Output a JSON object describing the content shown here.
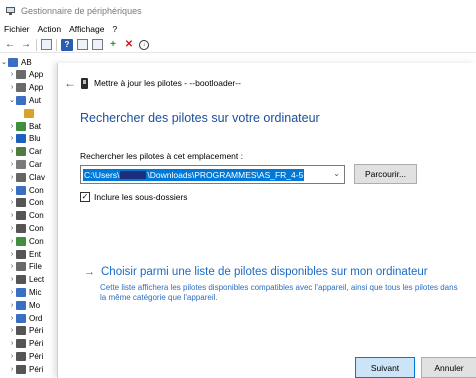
{
  "app": {
    "title": "Gestionnaire de périphériques"
  },
  "menu": [
    {
      "id": "fichier",
      "label": "Fichier"
    },
    {
      "id": "action",
      "label": "Action"
    },
    {
      "id": "affichage",
      "label": "Affichage"
    },
    {
      "id": "help",
      "label": "?"
    }
  ],
  "toolbar": [
    {
      "id": "back",
      "icon": "arrow-left-icon",
      "glyph": "←"
    },
    {
      "id": "forward",
      "icon": "arrow-right-icon",
      "glyph": "→"
    },
    {
      "id": "properties",
      "icon": "properties-icon",
      "glyph": ""
    },
    {
      "id": "help",
      "icon": "help-icon",
      "glyph": "?"
    },
    {
      "id": "update-driver",
      "icon": "update-driver-icon",
      "glyph": ""
    },
    {
      "id": "scan",
      "icon": "monitor-scan-icon",
      "glyph": ""
    },
    {
      "id": "add-legacy",
      "icon": "add-device-icon",
      "glyph": "+"
    },
    {
      "id": "uninstall",
      "icon": "uninstall-icon",
      "glyph": "✕"
    },
    {
      "id": "download",
      "icon": "download-icon",
      "glyph": "↓"
    }
  ],
  "tree": [
    {
      "label": "AB",
      "twisty": "⌄",
      "indent": 0,
      "color": "#3a6fc4"
    },
    {
      "label": "App",
      "twisty": "›",
      "indent": 1,
      "color": "#6a6a6a"
    },
    {
      "label": "App",
      "twisty": "›",
      "indent": 1,
      "color": "#6a6a6a"
    },
    {
      "label": "Aut",
      "twisty": "⌄",
      "indent": 1,
      "color": "#3a6fc4"
    },
    {
      "label": "",
      "twisty": "",
      "indent": 2,
      "color": "#d8a32a"
    },
    {
      "label": "Bat",
      "twisty": "›",
      "indent": 1,
      "color": "#3f8f3f"
    },
    {
      "label": "Blu",
      "twisty": "›",
      "indent": 1,
      "color": "#1e5fbf"
    },
    {
      "label": "Car",
      "twisty": "›",
      "indent": 1,
      "color": "#4f7d3f"
    },
    {
      "label": "Car",
      "twisty": "›",
      "indent": 1,
      "color": "#7a7a7a"
    },
    {
      "label": "Clav",
      "twisty": "›",
      "indent": 1,
      "color": "#666"
    },
    {
      "label": "Con",
      "twisty": "›",
      "indent": 1,
      "color": "#3a6fc4"
    },
    {
      "label": "Con",
      "twisty": "›",
      "indent": 1,
      "color": "#555"
    },
    {
      "label": "Con",
      "twisty": "›",
      "indent": 1,
      "color": "#555"
    },
    {
      "label": "Con",
      "twisty": "›",
      "indent": 1,
      "color": "#555"
    },
    {
      "label": "Con",
      "twisty": "›",
      "indent": 1,
      "color": "#3f8f3f"
    },
    {
      "label": "Ent",
      "twisty": "›",
      "indent": 1,
      "color": "#555"
    },
    {
      "label": "File",
      "twisty": "›",
      "indent": 1,
      "color": "#6a6a6a"
    },
    {
      "label": "Lect",
      "twisty": "›",
      "indent": 1,
      "color": "#555"
    },
    {
      "label": "Mic",
      "twisty": "›",
      "indent": 1,
      "color": "#3a6fc4"
    },
    {
      "label": "Mo",
      "twisty": "›",
      "indent": 1,
      "color": "#3a6fc4"
    },
    {
      "label": "Ord",
      "twisty": "›",
      "indent": 1,
      "color": "#3a6fc4"
    },
    {
      "label": "Péri",
      "twisty": "›",
      "indent": 1,
      "color": "#555"
    },
    {
      "label": "Péri",
      "twisty": "›",
      "indent": 1,
      "color": "#555"
    },
    {
      "label": "Péri",
      "twisty": "›",
      "indent": 1,
      "color": "#555"
    },
    {
      "label": "Péri",
      "twisty": "›",
      "indent": 1,
      "color": "#555"
    }
  ],
  "wizard": {
    "title": "Mettre à jour les pilotes - --bootloader--",
    "heading": "Rechercher des pilotes sur votre ordinateur",
    "search_label": "Rechercher les pilotes à cet emplacement :",
    "path_prefix": "C:\\Users\\",
    "path_suffix": "\\Downloads\\PROGRAMMES\\AS_FR_4-5",
    "browse_label": "Parcourir...",
    "include_subfolders_label": "Inclure les sous-dossiers",
    "include_subfolders_checked": true,
    "pick_link_label": "Choisir parmi une liste de pilotes disponibles sur mon ordinateur",
    "pick_link_desc": "Cette liste affichera les pilotes disponibles compatibles avec l'appareil, ainsi que tous les pilotes dans la même catégorie que l'appareil.",
    "next_label": "Suivant",
    "cancel_label": "Annuler"
  },
  "colors": {
    "heading": "#1b4f9c",
    "link": "#1b6ac9",
    "selection": "#0078d7"
  }
}
